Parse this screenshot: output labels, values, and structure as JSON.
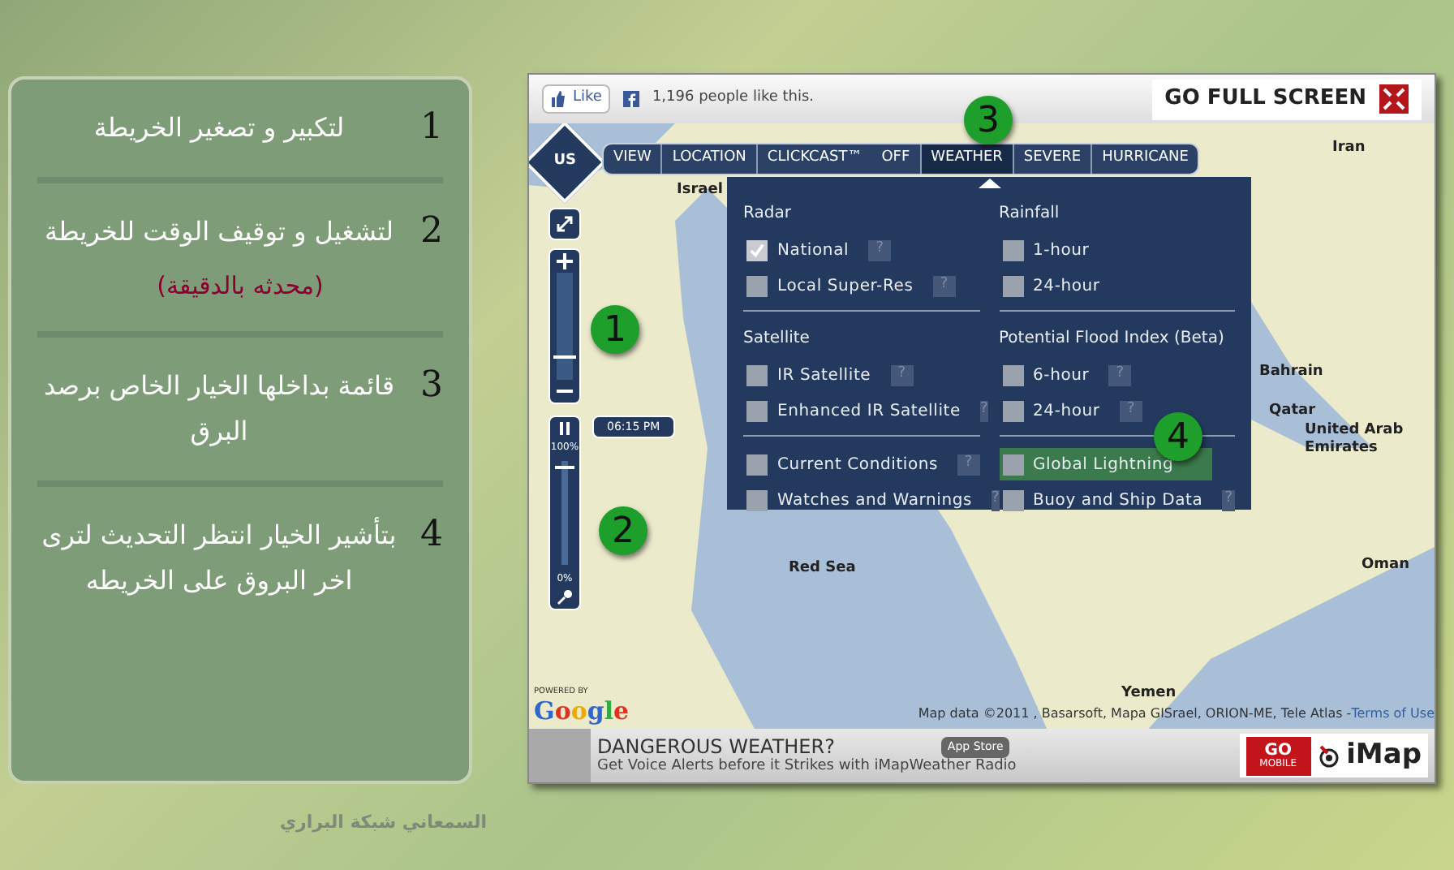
{
  "guide_panel": {
    "steps": [
      {
        "number": "1",
        "text": "لتكبير و تصغير الخريطة"
      },
      {
        "number": "2",
        "text": "لتشغيل و توقيف الوقت للخريطة",
        "note": "(محدثه بالدقيقة)"
      },
      {
        "number": "3",
        "text": "قائمة بداخلها الخيار الخاص برصد البرق"
      },
      {
        "number": "4",
        "text": "بتأشير الخيار انتظر التحديث لترى اخر البروق على الخريطه"
      }
    ]
  },
  "credit": "السمعاني شبكة البراري",
  "map_widget": {
    "top_bar": {
      "like_button": "Like",
      "like_count": "1,196 people like this.",
      "fullscreen_button": "GO FULL SCREEN"
    },
    "region_badge": "US",
    "tabs": [
      {
        "label": "VIEW",
        "selected": false
      },
      {
        "label": "LOCATION",
        "selected": false
      },
      {
        "label": "CLICKCAST™",
        "status": "OFF",
        "selected": false
      },
      {
        "label": "WEATHER",
        "selected": true
      },
      {
        "label": "SEVERE",
        "selected": false
      },
      {
        "label": "HURRICANE",
        "selected": false
      }
    ],
    "weather_menu": {
      "sections": [
        {
          "title": "Radar",
          "items": [
            {
              "label": "National",
              "checked": true,
              "highlighted": false,
              "help": "?"
            },
            {
              "label": "Local Super-Res",
              "checked": false,
              "highlighted": false,
              "help": "?"
            }
          ]
        },
        {
          "title": "Rainfall",
          "items": [
            {
              "label": "1-hour",
              "checked": false,
              "highlighted": false
            },
            {
              "label": "24-hour",
              "checked": false,
              "highlighted": false
            }
          ]
        },
        {
          "title": "Satellite",
          "items": [
            {
              "label": "IR Satellite",
              "checked": false,
              "highlighted": false,
              "help": "?"
            },
            {
              "label": "Enhanced IR Satellite",
              "checked": false,
              "highlighted": false,
              "help": "?"
            }
          ]
        },
        {
          "title": "Potential Flood Index (Beta)",
          "items": [
            {
              "label": "6-hour",
              "checked": false,
              "highlighted": false,
              "help": "?"
            },
            {
              "label": "24-hour",
              "checked": false,
              "highlighted": false,
              "help": "?"
            }
          ]
        },
        {
          "items": [
            {
              "label": "Current Conditions",
              "checked": false,
              "highlighted": false,
              "help": "?"
            },
            {
              "label": "Watches and Warnings",
              "checked": false,
              "highlighted": false,
              "help": "?"
            }
          ]
        },
        {
          "items": [
            {
              "label": "Global Lightning",
              "checked": false,
              "highlighted": true
            },
            {
              "label": "Buoy and Ship Data",
              "checked": false,
              "highlighted": false,
              "help": "?"
            }
          ]
        }
      ]
    },
    "zoom_slider": {
      "level": 0.2
    },
    "animation": {
      "playing": true,
      "time": "06:15 PM",
      "max_label": "100%",
      "min_label": "0%",
      "level": 0.92
    },
    "callouts": [
      "1",
      "2",
      "3",
      "4"
    ],
    "map_labels": [
      "Israel",
      "Iran",
      "Bahrain",
      "Qatar",
      "United Arab Emirates",
      "Oman",
      "Red Sea",
      "Yemen"
    ],
    "powered_by": "POWERED BY",
    "google_logo": "Google",
    "attribution": "Map data ©2011 , Basarsoft, Mapa GISrael, ORION-ME, Tele Atlas - ",
    "terms_link": "Terms of Use",
    "ad": {
      "headline": "DANGEROUS WEATHER?",
      "subline": "Get Voice Alerts before it Strikes with iMapWeather Radio",
      "app_store": "App Store",
      "go_mobile_line_1": "GO",
      "go_mobile_line_2": "MOBILE",
      "logo": "iMap"
    }
  }
}
